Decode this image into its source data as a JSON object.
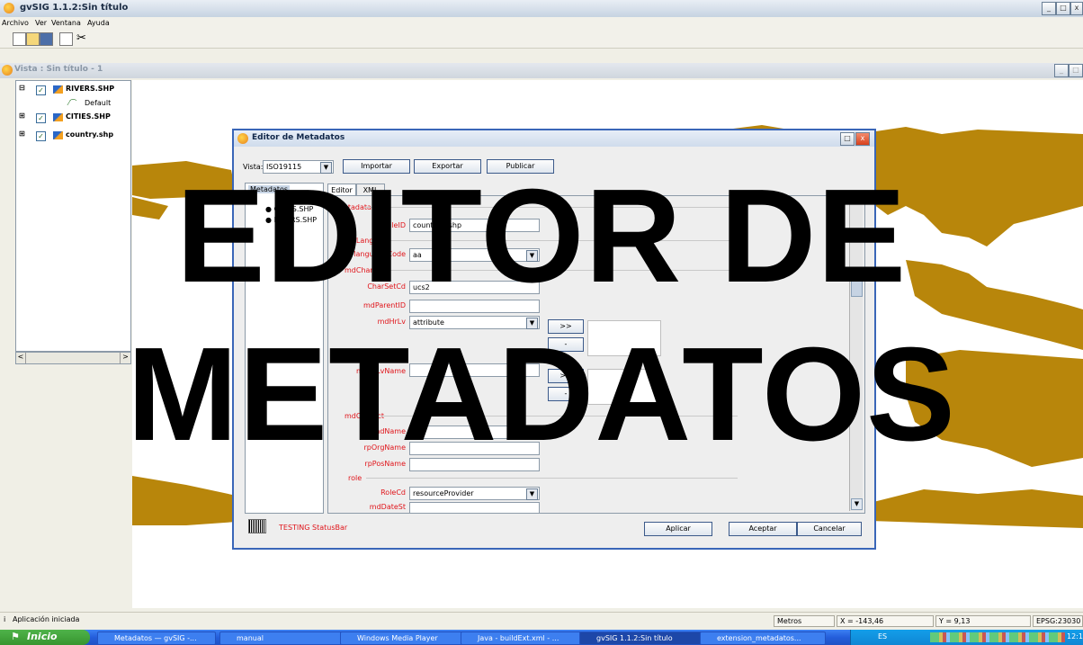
{
  "window": {
    "title": "gvSIG 1.1.2:Sin título"
  },
  "menu": [
    "Archivo",
    "Ver",
    "Ventana",
    "Ayuda"
  ],
  "view": {
    "title": "Vista : Sin título - 1"
  },
  "toc": {
    "layers": [
      {
        "name": "RIVERS.SHP",
        "checked": true,
        "legend": "Default"
      },
      {
        "name": "CITIES.SHP",
        "checked": true
      },
      {
        "name": "country.shp",
        "checked": true
      }
    ]
  },
  "dialog": {
    "title": "Editor de Metadatos",
    "vista_label": "Vista:",
    "vista_value": "ISO19115",
    "importar": "Importar",
    "exportar": "Exportar",
    "publicar": "Publicar",
    "tree": {
      "root": "Metadatos",
      "items": [
        "CITIES.SHP",
        "RIVERS.SHP"
      ]
    },
    "tabs": [
      "Editor",
      "XML"
    ],
    "section": "Metadata",
    "fields": {
      "mdFileID": {
        "label": "mdFileID",
        "value": "countries.shp"
      },
      "mdLang": {
        "label": "mdLang"
      },
      "languageCode": {
        "label": "languageCode",
        "value": "aa"
      },
      "mdChar": {
        "label": "mdChar"
      },
      "CharSetCd": {
        "label": "CharSetCd",
        "value": "ucs2"
      },
      "mdParentID": {
        "label": "mdParentID",
        "value": ""
      },
      "mdHrLv": {
        "label": "mdHrLv",
        "value": "attribute"
      },
      "mdHrLvName": {
        "label": "mdHrLvName",
        "value": ""
      },
      "mdContact": {
        "label": "mdContact"
      },
      "rpIndName": {
        "label": "rpIndName",
        "value": ""
      },
      "rpOrgName": {
        "label": "rpOrgName",
        "value": ""
      },
      "rpPosName": {
        "label": "rpPosName",
        "value": ""
      },
      "role": {
        "label": "role"
      },
      "RoleCd": {
        "label": "RoleCd",
        "value": "resourceProvider"
      },
      "mdDateSt": {
        "label": "mdDateSt",
        "value": ""
      }
    },
    "add_btn": ">>",
    "remove_btn": "-",
    "status": "TESTING StatusBar",
    "aplicar": "Aplicar",
    "aceptar": "Aceptar",
    "cancelar": "Cancelar"
  },
  "statusbar": {
    "message": "Aplicación iniciada",
    "units": "Metros",
    "x": "X = -143,46",
    "y": "Y = 9,13",
    "epsg": "EPSG:23030"
  },
  "taskbar": {
    "start": "Inicio",
    "tasks": [
      "Metadatos — gvSIG -...",
      "manual",
      "Windows Media Player",
      "Java - buildExt.xml - ...",
      "gvSIG 1.1.2:Sin título",
      "extension_metadatos..."
    ],
    "lang": "ES",
    "clock": "12:1"
  },
  "overlay": {
    "line1": "EDITOR DE",
    "line2": "METADATOS"
  },
  "colors": {
    "map_land": "#b8860b",
    "label_red": "#e0141a",
    "taskbar_blue": "#245edb"
  }
}
